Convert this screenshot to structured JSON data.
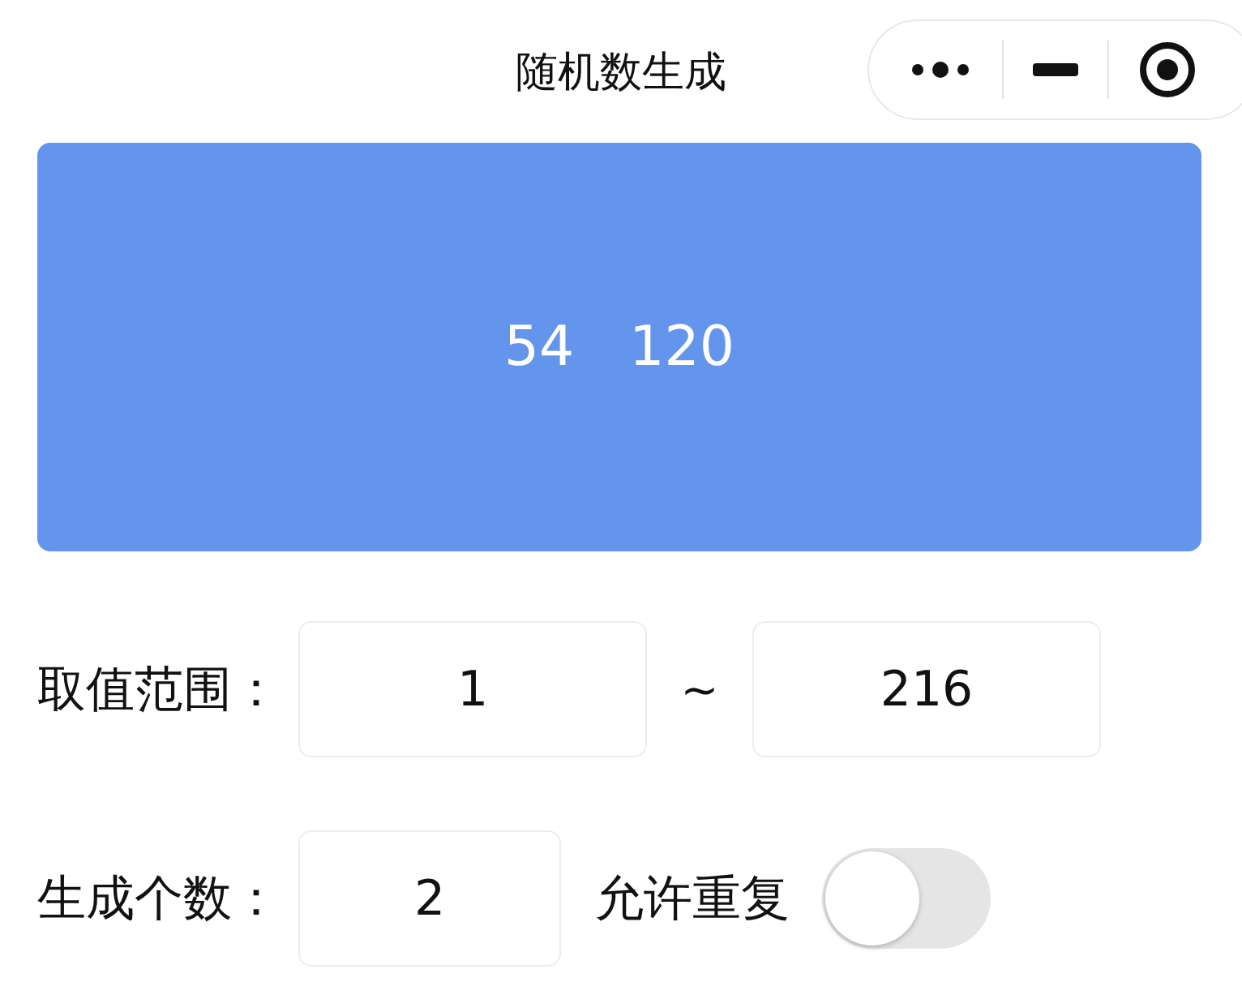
{
  "window": {
    "title": "随机数生成"
  },
  "results": [
    "54",
    "120"
  ],
  "range": {
    "label": "取值范围：",
    "min": "1",
    "separator": "~",
    "max": "216"
  },
  "count": {
    "label": "生成个数：",
    "value": "2"
  },
  "allow_repeat": {
    "label": "允许重复",
    "on": false
  }
}
